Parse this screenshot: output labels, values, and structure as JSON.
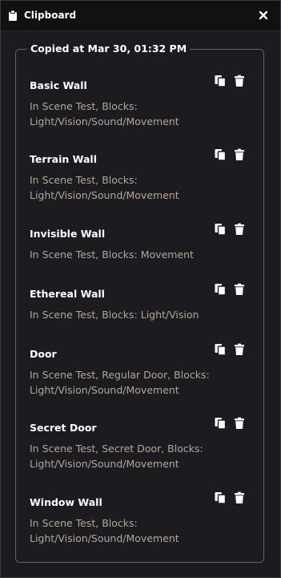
{
  "window": {
    "title": "Clipboard",
    "icons": {
      "title_icon": "clipboard-icon",
      "close": "close-icon"
    }
  },
  "group": {
    "legend": "Copied at Mar 30, 01:32 PM"
  },
  "items": [
    {
      "title": "Basic Wall",
      "description": "In Scene Test, Blocks: Light/Vision/Sound/Movement"
    },
    {
      "title": "Terrain Wall",
      "description": "In Scene Test, Blocks: Light/Vision/Sound/Movement"
    },
    {
      "title": "Invisible Wall",
      "description": "In Scene Test, Blocks: Movement"
    },
    {
      "title": "Ethereal Wall",
      "description": "In Scene Test, Blocks: Light/Vision"
    },
    {
      "title": "Door",
      "description": "In Scene Test, Regular Door, Blocks: Light/Vision/Sound/Movement"
    },
    {
      "title": "Secret Door",
      "description": "In Scene Test, Secret Door, Blocks: Light/Vision/Sound/Movement"
    },
    {
      "title": "Window Wall",
      "description": "In Scene Test, Blocks: Light/Vision/Sound/Movement"
    }
  ],
  "item_icons": {
    "copy": "copy-icon",
    "delete": "trash-icon"
  },
  "colors": {
    "background": "#1c1b1f",
    "titlebar": "#111111",
    "text": "#ffffff",
    "description": "#b5a69b",
    "border": "#6a625c"
  }
}
